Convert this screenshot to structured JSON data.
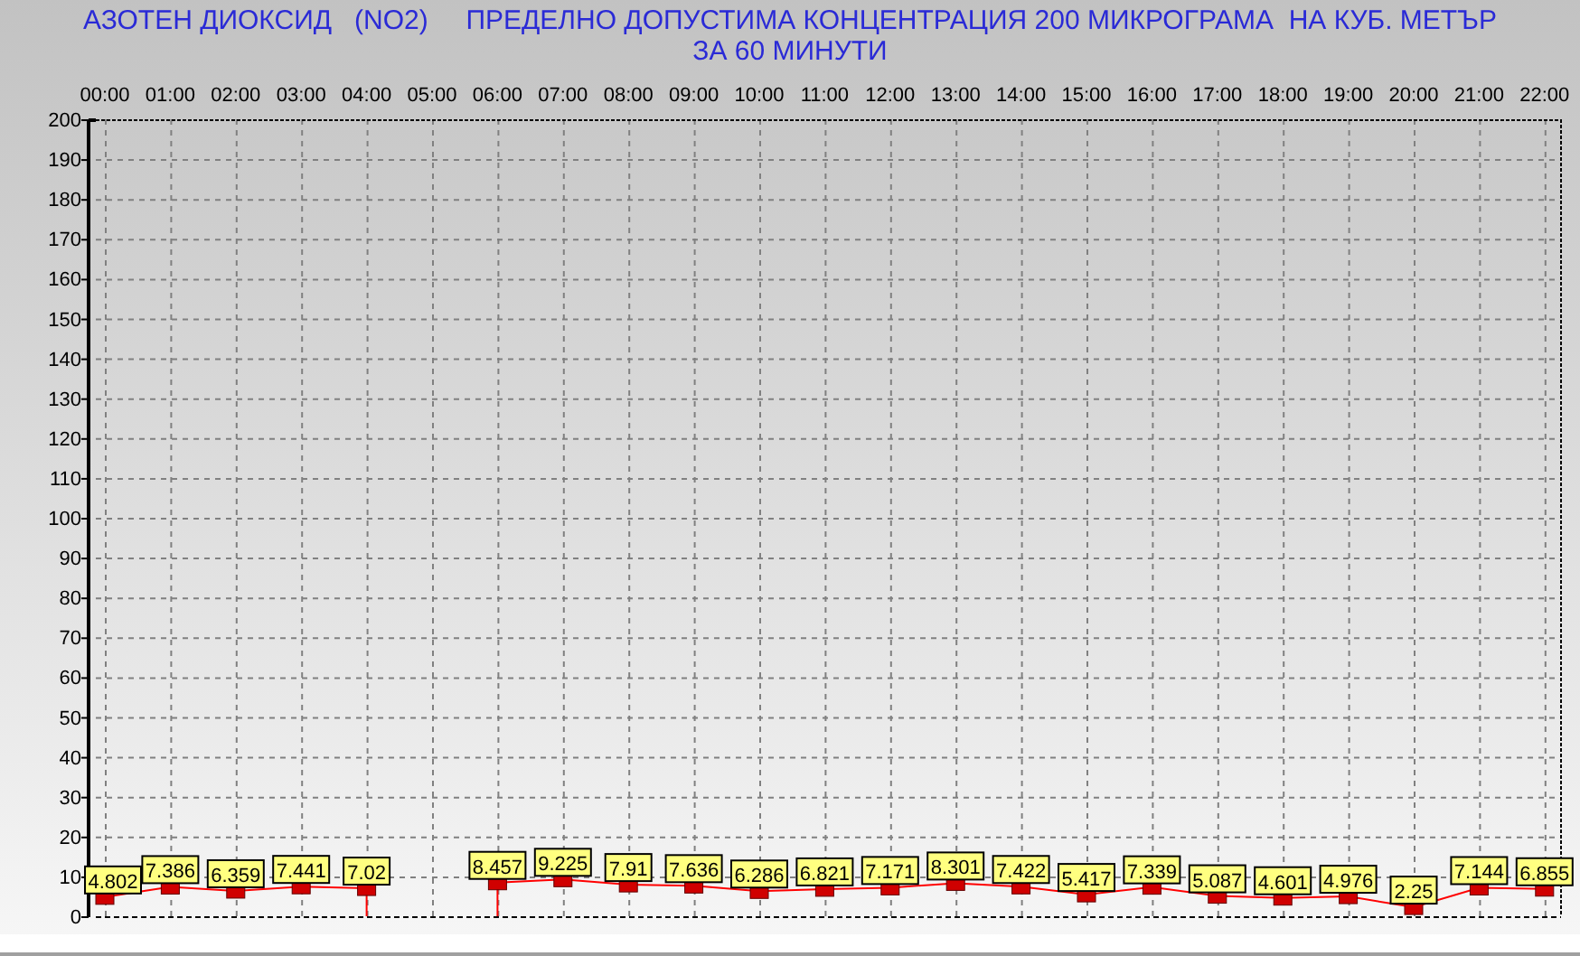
{
  "title_lines": [
    "АЗОТЕН ДИОКСИД   (NO2)     ПРЕДЕЛНО ДОПУСТИМА КОНЦЕНТРАЦИЯ 200 МИКРОГРАМА  НА КУБ. МЕТЪР",
    "ЗА 60 МИНУТИ"
  ],
  "chart_data": {
    "type": "line",
    "categories": [
      "00:00",
      "01:00",
      "02:00",
      "03:00",
      "04:00",
      "05:00",
      "06:00",
      "07:00",
      "08:00",
      "09:00",
      "10:00",
      "11:00",
      "12:00",
      "13:00",
      "14:00",
      "15:00",
      "16:00",
      "17:00",
      "18:00",
      "19:00",
      "20:00",
      "21:00",
      "22:00"
    ],
    "series": [
      {
        "color": "#ff0000",
        "values": [
          4.802,
          7.386,
          6.359,
          7.441,
          7.02,
          null,
          8.457,
          9.225,
          7.91,
          7.636,
          6.286,
          6.821,
          7.171,
          8.301,
          7.422,
          5.417,
          7.339,
          5.087,
          4.601,
          4.976,
          2.25,
          7.144,
          6.855
        ]
      }
    ],
    "ylim": [
      0,
      200
    ],
    "yticks": [
      0,
      10,
      20,
      30,
      40,
      50,
      60,
      70,
      80,
      90,
      100,
      110,
      120,
      130,
      140,
      150,
      160,
      170,
      180,
      190,
      200
    ],
    "grid": true,
    "marker": "square",
    "data_labels": true
  }
}
